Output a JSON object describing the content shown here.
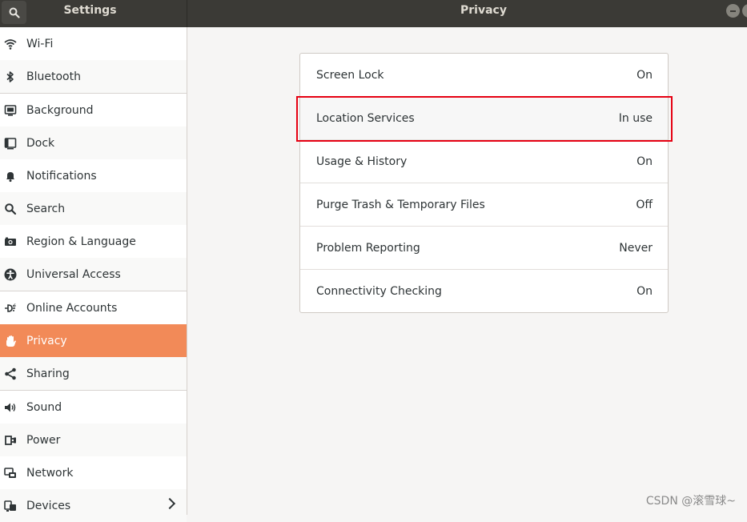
{
  "header": {
    "sidebar_title": "Settings",
    "main_title": "Privacy",
    "search_icon": "search-icon"
  },
  "sidebar": {
    "items": [
      {
        "label": "Wi-Fi",
        "icon": "wifi-icon"
      },
      {
        "label": "Bluetooth",
        "icon": "bluetooth-icon"
      },
      {
        "label": "Background",
        "icon": "background-icon"
      },
      {
        "label": "Dock",
        "icon": "dock-icon"
      },
      {
        "label": "Notifications",
        "icon": "bell-icon"
      },
      {
        "label": "Search",
        "icon": "search-icon"
      },
      {
        "label": "Region & Language",
        "icon": "camera-icon"
      },
      {
        "label": "Universal Access",
        "icon": "accessibility-icon"
      },
      {
        "label": "Online Accounts",
        "icon": "online-accounts-icon"
      },
      {
        "label": "Privacy",
        "icon": "hand-icon",
        "selected": true
      },
      {
        "label": "Sharing",
        "icon": "share-icon"
      },
      {
        "label": "Sound",
        "icon": "speaker-icon"
      },
      {
        "label": "Power",
        "icon": "power-icon"
      },
      {
        "label": "Network",
        "icon": "network-icon"
      },
      {
        "label": "Devices",
        "icon": "devices-icon",
        "has_chevron": true
      }
    ]
  },
  "privacy": {
    "rows": [
      {
        "label": "Screen Lock",
        "value": "On"
      },
      {
        "label": "Location Services",
        "value": "In use",
        "highlighted": true
      },
      {
        "label": "Usage & History",
        "value": "On"
      },
      {
        "label": "Purge Trash & Temporary Files",
        "value": "Off"
      },
      {
        "label": "Problem Reporting",
        "value": "Never"
      },
      {
        "label": "Connectivity Checking",
        "value": "On"
      }
    ]
  },
  "colors": {
    "selected_bg": "#f28a58",
    "header_bg": "#3b3a36",
    "highlight_border": "#e60012"
  },
  "watermark": "CSDN @滚雪球~"
}
